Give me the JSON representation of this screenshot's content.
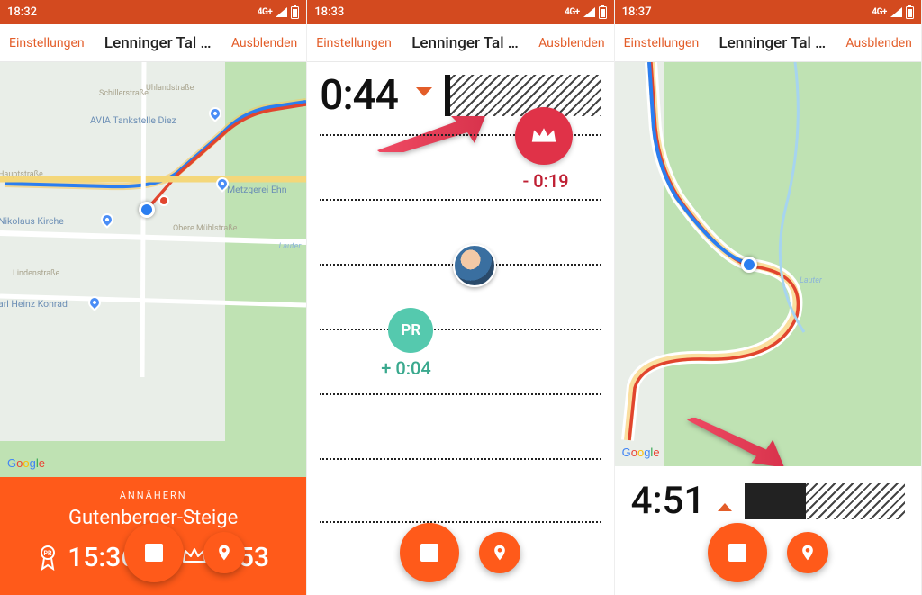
{
  "screens": [
    {
      "status_time": "18:32",
      "network": "4G+",
      "settings": "Einstellungen",
      "title": "Lenninger Tal …",
      "hide": "Ausblenden",
      "pois": {
        "avia": "AVIA Tankstelle Diez",
        "metzgerei": "Metzgerei Ehn",
        "kirche": "Nikolaus Kirche",
        "konrad": "arl Heinz Konrad",
        "schiller": "Schillerstraße",
        "uhland": "Uhlandstraße",
        "haupt": "Hauptstraße",
        "muhl": "Obere Mühlstraße",
        "linden": "Lindenstraße",
        "lauter": "Lauter"
      },
      "google": "Google",
      "seg_label": "ANNÄHERN",
      "seg_name": "Gutenberger-Steige",
      "pr_time": "15:36",
      "kom_time": "7:53"
    },
    {
      "status_time": "18:33",
      "network": "4G+",
      "settings": "Einstellungen",
      "title": "Lenninger Tal …",
      "hide": "Ausblenden",
      "elapsed": "0:44",
      "kom_delta": "- 0:19",
      "pr_label": "PR",
      "pr_delta": "+ 0:04"
    },
    {
      "status_time": "18:37",
      "network": "4G+",
      "settings": "Einstellungen",
      "title": "Lenninger Tal …",
      "hide": "Ausblenden",
      "google": "Google",
      "elapsed": "4:51",
      "progress_pct": 38
    }
  ]
}
